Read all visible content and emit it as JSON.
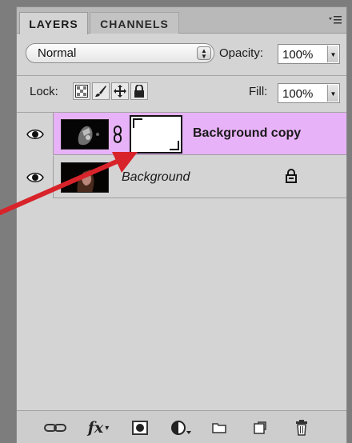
{
  "tabs": [
    {
      "label": "LAYERS",
      "active": true
    },
    {
      "label": "CHANNELS",
      "active": false
    }
  ],
  "blend_mode": {
    "value": "Normal"
  },
  "opacity": {
    "label": "Opacity:",
    "value": "100%"
  },
  "lock": {
    "label": "Lock:",
    "icons": [
      "transparency-lock-icon",
      "brush-lock-icon",
      "move-lock-icon",
      "padlock-icon"
    ]
  },
  "fill": {
    "label": "Fill:",
    "value": "100%"
  },
  "layers": [
    {
      "name": "Background copy",
      "selected": true,
      "has_mask": true,
      "visible": true
    },
    {
      "name": "Background",
      "selected": false,
      "locked": true,
      "visible": true
    }
  ],
  "bottom_icons": [
    "link-layers-icon",
    "fx-icon",
    "add-mask-icon",
    "adjustment-layer-icon",
    "new-group-icon",
    "new-layer-icon",
    "trash-icon"
  ],
  "fx_label": "fx",
  "colors": {
    "selected_row": "#e8b2f8",
    "annotation_arrow": "#d8232a"
  }
}
